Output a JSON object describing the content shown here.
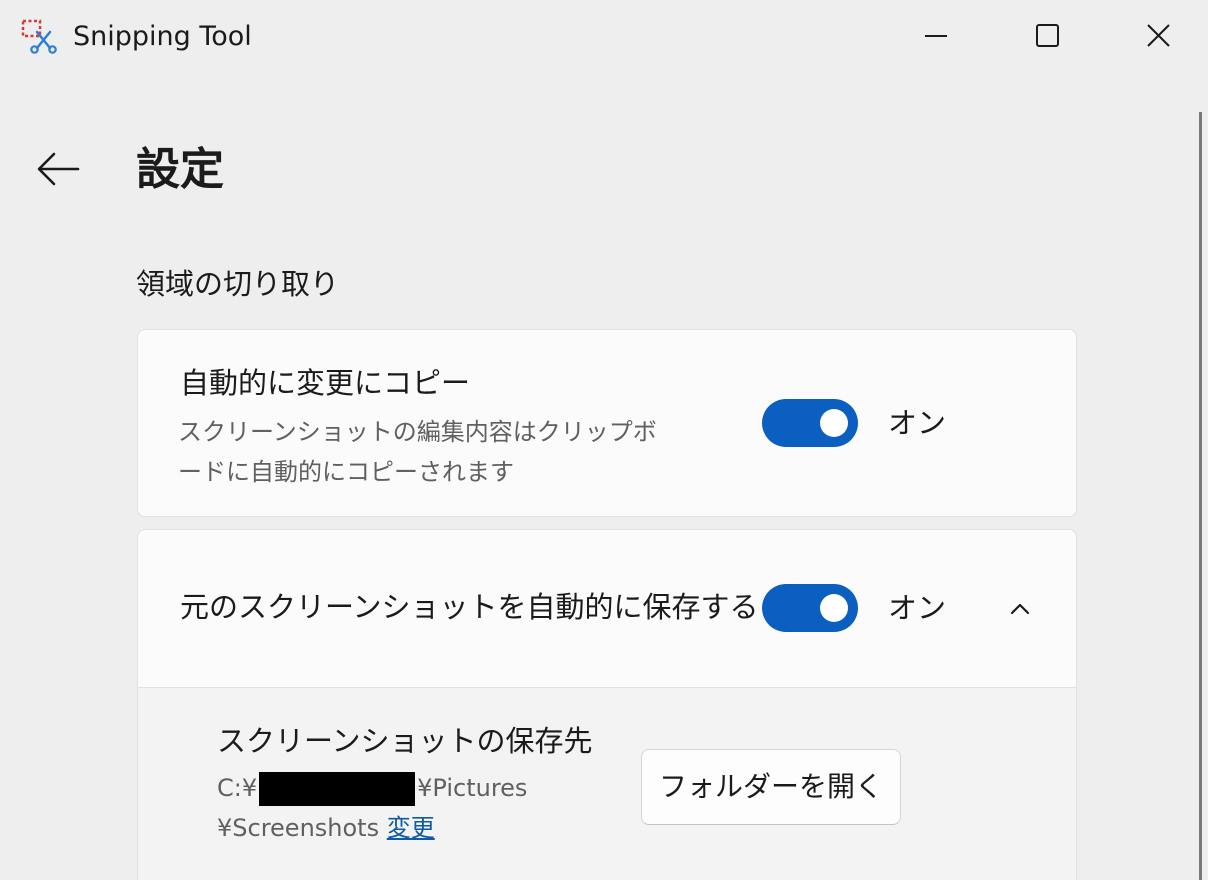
{
  "window": {
    "title": "Snipping Tool",
    "icon": "snipping-tool-icon",
    "controls": [
      "minimize-icon",
      "maximize-icon",
      "close-icon"
    ]
  },
  "header": {
    "back_icon": "arrow-left-icon",
    "page_title": "設定"
  },
  "section": {
    "title": "領域の切り取り"
  },
  "settings": [
    {
      "title": "自動的に変更にコピー",
      "description": "スクリーンショットの編集内容はクリップボードに自動的にコピーされます",
      "toggle_state": "オン",
      "toggle_on": true
    },
    {
      "title": "元のスクリーンショットを自動的に保存する",
      "toggle_state": "オン",
      "toggle_on": true,
      "expanded": true,
      "chevron_icon": "chevron-up-icon",
      "sub": {
        "title": "スクリーンショットの保存先",
        "path_prefix": "C:¥",
        "path_suffix": "¥Pictures",
        "path_line2": "¥Screenshots",
        "change_link": "変更",
        "open_folder_button": "フォルダーを開く"
      }
    }
  ],
  "colors": {
    "accent": "#0a5fc0",
    "background": "#eeeeee",
    "card": "#fbfbfb",
    "link": "#0f5aa6"
  }
}
